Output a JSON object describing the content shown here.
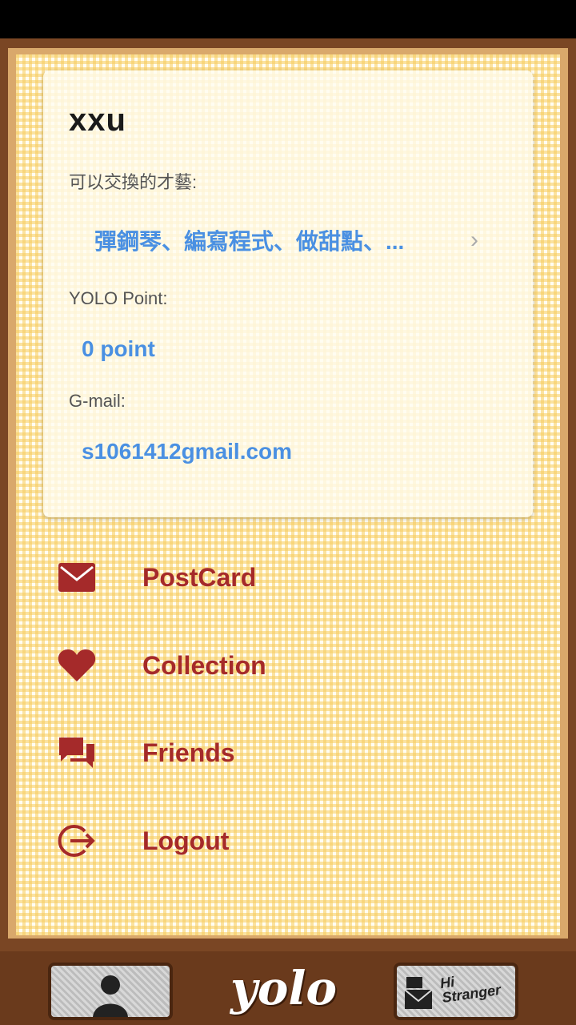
{
  "profile": {
    "username": "xxu",
    "talents_label": "可以交換的才藝:",
    "talents_value": "彈鋼琴、編寫程式、做甜點、...",
    "points_label": "YOLO Point:",
    "points_value": "0 point",
    "email_label": "G-mail:",
    "email_value": "s1061412gmail.com"
  },
  "menu": {
    "items": [
      {
        "label": "PostCard",
        "icon": "envelope-icon"
      },
      {
        "label": "Collection",
        "icon": "heart-icon"
      },
      {
        "label": "Friends",
        "icon": "chat-icon"
      },
      {
        "label": "Logout",
        "icon": "logout-icon"
      }
    ]
  },
  "bottom_bar": {
    "logo_text": "yolo",
    "hi_line1": "Hi",
    "hi_line2": "Stranger"
  },
  "colors": {
    "accent_link": "#4a90e2",
    "menu_red": "#a52a2a",
    "frame_brown": "#7a4624"
  }
}
